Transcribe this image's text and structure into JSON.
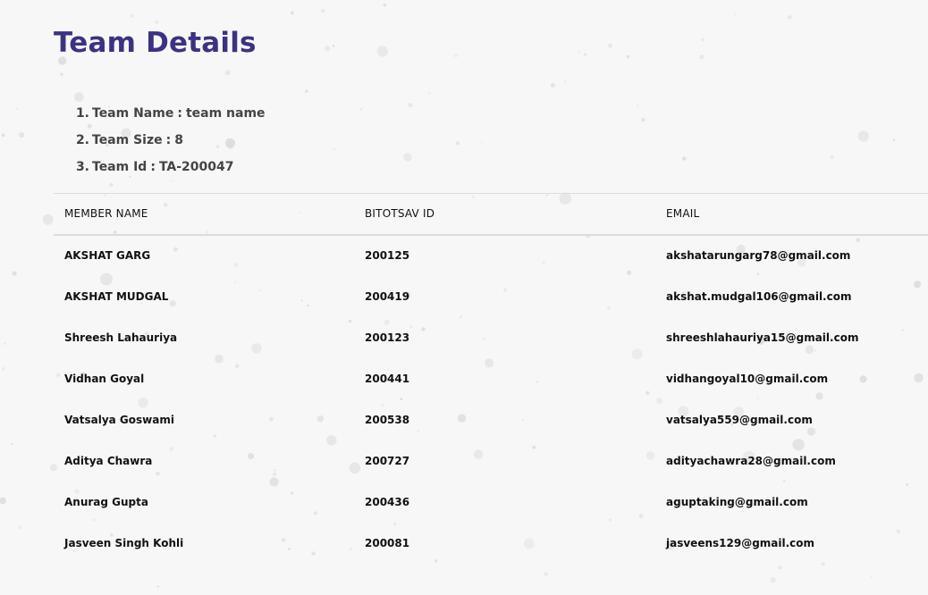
{
  "page": {
    "title": "Team Details",
    "accent_color": "#3b3381",
    "background_color": "#f7f7f8"
  },
  "team_info": [
    {
      "number": "1.",
      "label": "Team Name",
      "separator": ":",
      "value": "team name"
    },
    {
      "number": "2.",
      "label": "Team Size",
      "separator": ":",
      "value": "8"
    },
    {
      "number": "3.",
      "label": "Team Id",
      "separator": ":",
      "value": "TA-200047"
    }
  ],
  "members_table": {
    "columns": [
      "MEMBER NAME",
      "BITOTSAV ID",
      "EMAIL"
    ],
    "rows": [
      {
        "name": "AKSHAT GARG",
        "id": "200125",
        "email": "akshatarungarg78@gmail.com"
      },
      {
        "name": "AKSHAT MUDGAL",
        "id": "200419",
        "email": "akshat.mudgal106@gmail.com"
      },
      {
        "name": "Shreesh Lahauriya",
        "id": "200123",
        "email": "shreeshlahauriya15@gmail.com"
      },
      {
        "name": "Vidhan Goyal",
        "id": "200441",
        "email": "vidhangoyal10@gmail.com"
      },
      {
        "name": "Vatsalya Goswami",
        "id": "200538",
        "email": "vatsalya559@gmail.com"
      },
      {
        "name": "Aditya Chawra",
        "id": "200727",
        "email": "adityachawra28@gmail.com"
      },
      {
        "name": "Anurag Gupta",
        "id": "200436",
        "email": "aguptaking@gmail.com"
      },
      {
        "name": "Jasveen Singh Kohli",
        "id": "200081",
        "email": "jasveens129@gmail.com"
      }
    ]
  }
}
